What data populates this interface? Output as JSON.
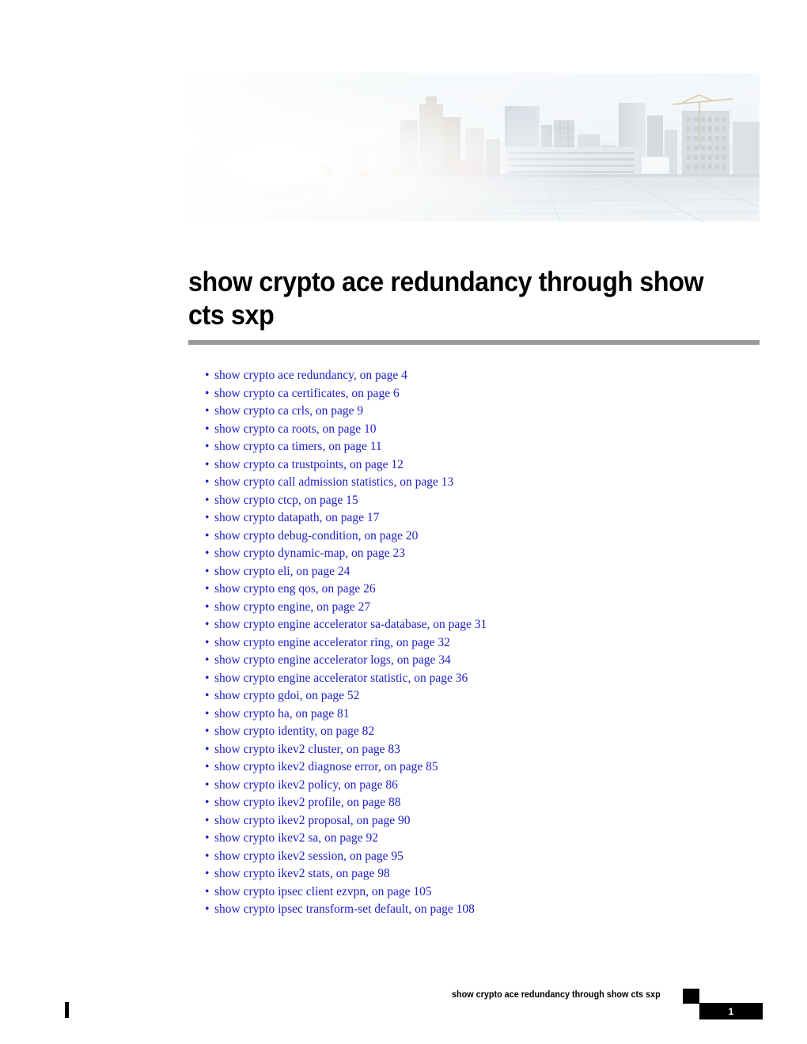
{
  "document": {
    "chapter_title": "show crypto ace redundancy through show cts sxp",
    "banner_alt": "cityscape-banner-image"
  },
  "colors": {
    "link": "#2020c8",
    "rule": "#9a9a9a",
    "footer_bar": "#000000",
    "text": "#000000"
  },
  "toc": {
    "bullet": "•",
    "items": [
      {
        "label": "show crypto ace redundancy, on page 4"
      },
      {
        "label": "show crypto ca certificates, on page 6"
      },
      {
        "label": "show crypto ca crls, on page 9"
      },
      {
        "label": "show crypto ca roots, on page 10"
      },
      {
        "label": "show crypto ca timers, on page 11"
      },
      {
        "label": "show crypto ca trustpoints, on page 12"
      },
      {
        "label": "show crypto call admission statistics, on page 13"
      },
      {
        "label": "show crypto ctcp, on page 15"
      },
      {
        "label": "show crypto datapath, on page 17"
      },
      {
        "label": "show crypto debug-condition, on page 20"
      },
      {
        "label": "show crypto dynamic-map, on page 23"
      },
      {
        "label": "show crypto eli, on page 24"
      },
      {
        "label": "show crypto eng qos, on page 26"
      },
      {
        "label": "show crypto engine, on page 27"
      },
      {
        "label": "show crypto engine accelerator sa-database, on page 31"
      },
      {
        "label": "show crypto engine accelerator ring, on page 32"
      },
      {
        "label": "show crypto engine accelerator logs, on page 34"
      },
      {
        "label": "show crypto engine accelerator statistic, on page 36"
      },
      {
        "label": "show crypto gdoi, on page 52"
      },
      {
        "label": "show crypto ha, on page 81"
      },
      {
        "label": "show crypto identity, on page 82"
      },
      {
        "label": "show crypto ikev2 cluster, on page 83"
      },
      {
        "label": "show crypto ikev2 diagnose error, on page 85"
      },
      {
        "label": "show crypto ikev2 policy, on page 86"
      },
      {
        "label": "show crypto ikev2 profile, on page 88"
      },
      {
        "label": "show crypto ikev2 proposal, on page 90"
      },
      {
        "label": "show crypto ikev2 sa, on page 92"
      },
      {
        "label": "show crypto ikev2 session, on page 95"
      },
      {
        "label": "show crypto ikev2 stats, on page 98"
      },
      {
        "label": "show crypto ipsec client ezvpn, on page 105"
      },
      {
        "label": "show crypto ipsec transform-set default, on page 108"
      }
    ]
  },
  "footer": {
    "chapter_title": "show crypto ace redundancy through show cts sxp",
    "page_number": "1"
  }
}
